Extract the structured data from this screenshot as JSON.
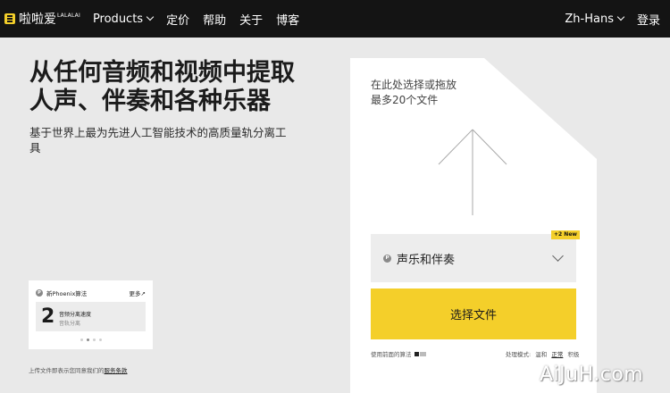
{
  "header": {
    "brand": "啦啦爱",
    "brand_sup": "LALALAI",
    "nav": [
      {
        "label": "Products"
      },
      {
        "label": "定价"
      },
      {
        "label": "帮助"
      },
      {
        "label": "关于"
      },
      {
        "label": "博客"
      }
    ],
    "language": "Zh-Hans",
    "login": "登录"
  },
  "hero": {
    "title": "从任何音频和视频中提取人声、伴奏和各种乐器",
    "subtitle": "基于世界上最为先进人工智能技术的高质量轨分离工具"
  },
  "promo_card": {
    "badge": "P",
    "title": "新Phoenix算法",
    "more": "更多↗",
    "number": "2",
    "line1": "音频分离速度",
    "line2": "音轨分离",
    "dots": 4,
    "active_dot": 1
  },
  "terms": {
    "text": "上传文件即表示您同意我们的",
    "link": "服务条款"
  },
  "upload": {
    "line1": "在此处选择或拖放",
    "line2": "最多20个文件",
    "select_badge": "P",
    "select_label": "声乐和伴奏",
    "new_tag": "+2 New",
    "choose_button": "选择文件",
    "algo_text": "使用前面的算法",
    "mode_label": "处理模式:",
    "modes": [
      "温和",
      "正常",
      "积极"
    ],
    "active_mode": "正常"
  },
  "watermark": "AiJuH.com",
  "colors": {
    "accent": "#f4cf2a",
    "topbar": "#141414",
    "background": "#e9e9e9"
  }
}
